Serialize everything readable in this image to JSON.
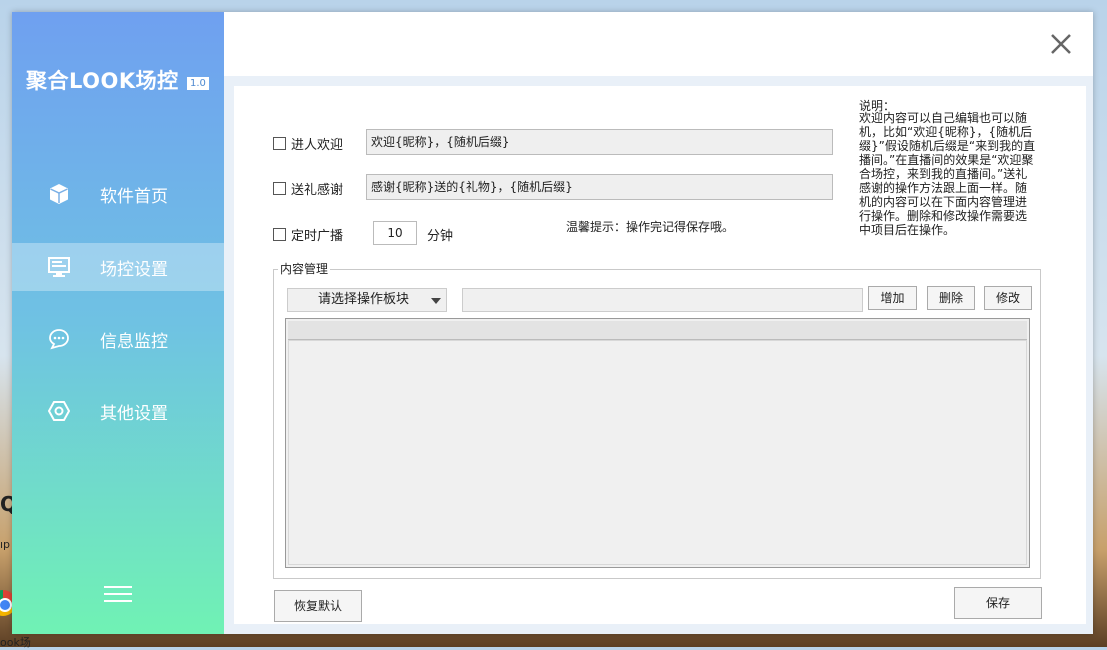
{
  "app": {
    "title": "聚合LOOK场控",
    "version": "1.0"
  },
  "sidebar": {
    "items": [
      {
        "label": "软件首页",
        "icon": "cube-icon"
      },
      {
        "label": "场控设置",
        "icon": "monitor-icon",
        "active": true
      },
      {
        "label": "信息监控",
        "icon": "chat-bubble-icon"
      },
      {
        "label": "其他设置",
        "icon": "hexagon-settings-icon"
      }
    ]
  },
  "settings": {
    "welcome": {
      "label": "进人欢迎",
      "checked": false,
      "value": "欢迎{昵称}，{随机后缀}"
    },
    "gift": {
      "label": "送礼感谢",
      "checked": false,
      "value": "感谢{昵称}送的{礼物}，{随机后缀}"
    },
    "broadcast": {
      "label": "定时广播",
      "checked": false,
      "minutes": "10",
      "unit": "分钟"
    },
    "tip": "温馨提示：操作完记得保存哦。"
  },
  "explanation": {
    "title": "说明：",
    "text": "欢迎内容可以自己编辑也可以随机，比如“欢迎{昵称}，{随机后缀}”假设随机后缀是“来到我的直播间。”在直播间的效果是“欢迎聚合场控，来到我的直播间。”送礼感谢的操作方法跟上面一样。随机的内容可以在下面内容管理进行操作。删除和修改操作需要选中项目后在操作。"
  },
  "content_manage": {
    "title": "内容管理",
    "select_placeholder": "请选择操作板块",
    "add": "增加",
    "delete": "删除",
    "edit": "修改"
  },
  "footer": {
    "reset": "恢复默认",
    "save": "保存"
  },
  "desktop": {
    "frag1": "Q",
    "frag2": "ıp",
    "frag3": "ook场"
  },
  "colors": {
    "sidebar_top": "#6fa0f0",
    "sidebar_bottom": "#70f2b4"
  }
}
